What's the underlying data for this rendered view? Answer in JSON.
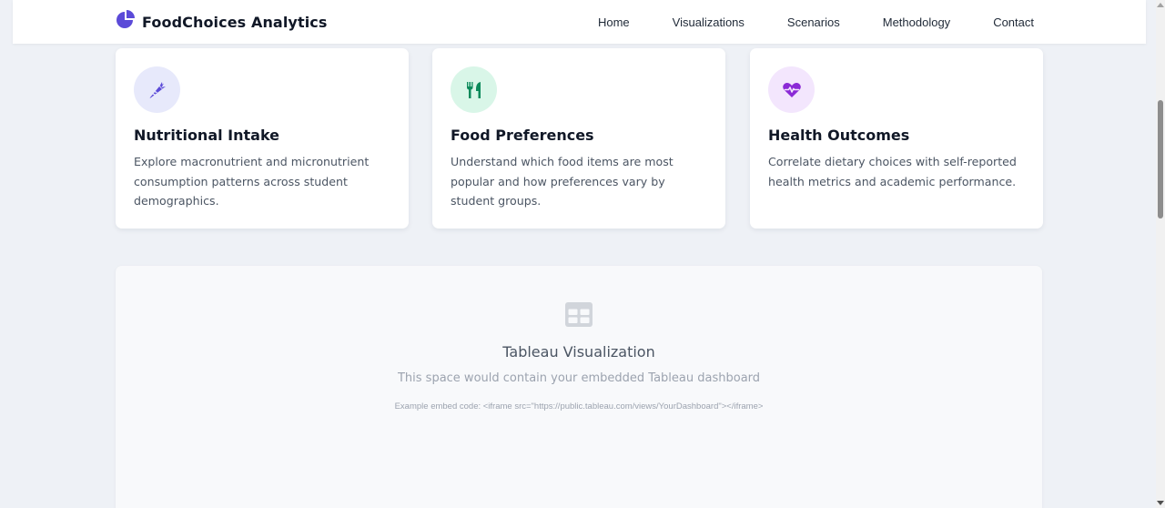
{
  "header": {
    "brand": "FoodChoices Analytics",
    "brand_icon": "pie-chart-icon",
    "nav": [
      "Home",
      "Visualizations",
      "Scenarios",
      "Methodology",
      "Contact"
    ]
  },
  "cards": [
    {
      "title": "Nutritional Intake",
      "desc": "Explore macronutrient and micronutrient consumption patterns across student demographics.",
      "icon": "carrot-icon",
      "accent": "#5b4ad8",
      "icon_bg": "#e7e9fb"
    },
    {
      "title": "Food Preferences",
      "desc": "Understand which food items are most popular and how preferences vary by student groups.",
      "icon": "utensils-icon",
      "accent": "#0c8a5b",
      "icon_bg": "#d9f6e8"
    },
    {
      "title": "Health Outcomes",
      "desc": "Correlate dietary choices with self-reported health metrics and academic performance.",
      "icon": "heart-pulse-icon",
      "accent": "#8b2ad6",
      "icon_bg": "#f3e6fd"
    }
  ],
  "tableau": {
    "icon": "table-icon",
    "title": "Tableau Visualization",
    "subtitle": "This space would contain your embedded Tableau dashboard",
    "code": "Example embed code: <iframe src=\"https://public.tableau.com/views/YourDashboard\"></iframe>"
  },
  "colors": {
    "page_bg": "#eef1f6",
    "brand_accent": "#5b4ad8"
  }
}
